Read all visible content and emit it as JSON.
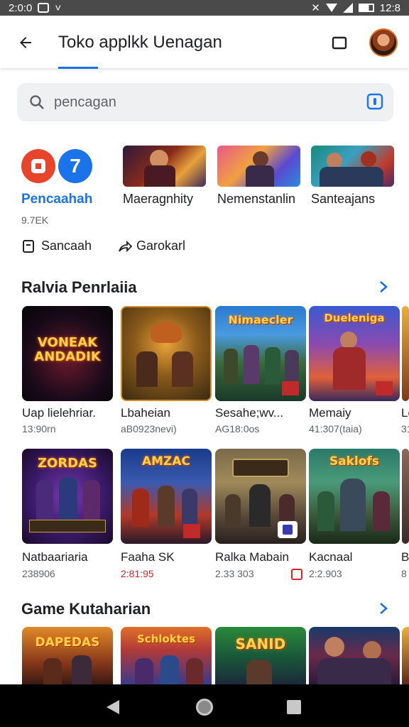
{
  "status_bar": {
    "time_left": "2:0:0",
    "time_right": "12:8"
  },
  "app_bar": {
    "title": "Toko applkk Uenagan"
  },
  "search": {
    "placeholder": "pencagan"
  },
  "featured": {
    "badge_number": "7",
    "name": "Pencaahah",
    "count": "9.7EK",
    "save_label": "Sancaah",
    "share_label": "Garokarl",
    "heroes": [
      {
        "label": "Maeragnhity"
      },
      {
        "label": "Nemenstanlin"
      },
      {
        "label": "Santeajans"
      }
    ]
  },
  "section1": {
    "title": "Ralvia Penrlaiia",
    "games": [
      {
        "tile_text": "VONEAK ANDADIK",
        "name": "Uap lielehriar.",
        "sub": "13:90rn"
      },
      {
        "tile_text": "",
        "name": "Lbaheian",
        "sub": "aB0923nevi)"
      },
      {
        "tile_text": "Nimaecler",
        "name": "Sesahe;wv...",
        "sub": "AG18:0os"
      },
      {
        "tile_text": "Dueleniga",
        "name": "Memaiy",
        "sub": "41:307(taia)"
      },
      {
        "tile_text": "",
        "name": "Lo",
        "sub": "31"
      }
    ],
    "games_row2": [
      {
        "tile_text": "ZORDAS",
        "name": "Natbaariaria",
        "sub": "238906"
      },
      {
        "tile_text": "AMZAC",
        "name": "Faaha SK",
        "sub": "2:81:95"
      },
      {
        "tile_text": "",
        "name": "Ralka Mabain",
        "sub": "2.33 303"
      },
      {
        "tile_text": "Saklofs",
        "name": "Kacnaal",
        "sub": "2:2.903"
      },
      {
        "tile_text": "",
        "name": "B",
        "sub": "8"
      }
    ]
  },
  "section2": {
    "title": "Game Kutaharian",
    "games": [
      {
        "tile_text": "DAPEDAS"
      },
      {
        "tile_text": "Schloktes"
      },
      {
        "tile_text": "SANID"
      },
      {
        "tile_text": ""
      }
    ]
  },
  "colors": {
    "accent": "#1a73e8",
    "chip_bg": "#eef0f2",
    "nav_bg": "#000000",
    "status_bg": "#4a4a4a"
  },
  "icons": [
    "back-arrow-icon",
    "cast-icon",
    "search-icon",
    "voice-search-icon",
    "bookmark-icon",
    "share-icon",
    "chevron-right-icon"
  ]
}
